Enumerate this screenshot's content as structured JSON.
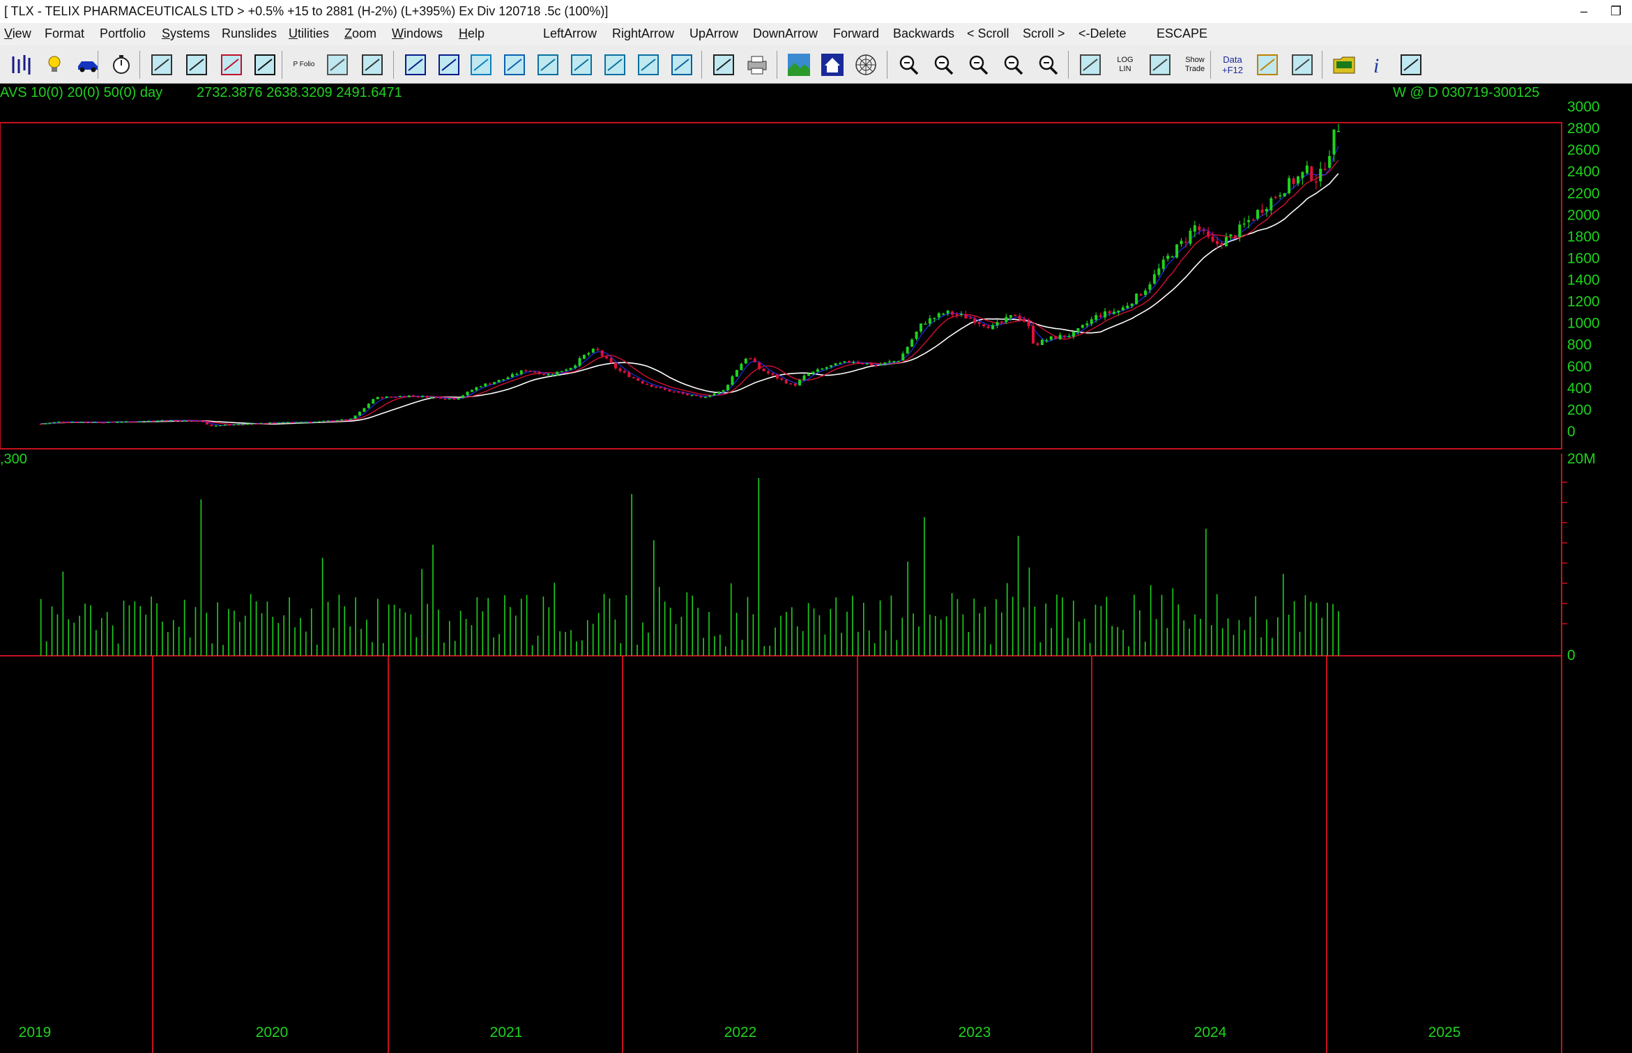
{
  "window": {
    "title": "[ TLX - TELIX PHARMACEUTICALS LTD > +0.5% +15 to 2881 (H-2%) (L+395%)    Ex Div 120718  .5c  (100%)]",
    "minimize_glyph": "–",
    "maximize_glyph": "❐"
  },
  "menu": [
    {
      "label": "View",
      "ul": "V",
      "rest": "iew"
    },
    {
      "label": "Format",
      "ul": "",
      "rest": "Format"
    },
    {
      "label": "Portfolio",
      "ul": "",
      "rest": "Portfolio"
    },
    {
      "label": "Systems",
      "ul": "S",
      "rest": "ystems"
    },
    {
      "label": "Runslides",
      "ul": "",
      "rest": "Runslides"
    },
    {
      "label": "Utilities",
      "ul": "U",
      "rest": "tilities"
    },
    {
      "label": "Zoom",
      "ul": "Z",
      "rest": "oom"
    },
    {
      "label": "Windows",
      "ul": "W",
      "rest": "indows"
    },
    {
      "label": "Help",
      "ul": "H",
      "rest": "elp"
    },
    {
      "label": "LeftArrow",
      "ul": "",
      "rest": "LeftArrow"
    },
    {
      "label": "RightArrow",
      "ul": "",
      "rest": "RightArrow"
    },
    {
      "label": "UpArrow",
      "ul": "",
      "rest": "UpArrow"
    },
    {
      "label": "DownArrow",
      "ul": "",
      "rest": "DownArrow"
    },
    {
      "label": "Forward",
      "ul": "",
      "rest": "Forward"
    },
    {
      "label": "Backwards",
      "ul": "",
      "rest": "Backwards"
    },
    {
      "label": "< Scroll",
      "ul": "",
      "rest": "< Scroll"
    },
    {
      "label": "Scroll >",
      "ul": "",
      "rest": "Scroll >"
    },
    {
      "label": "<-Delete",
      "ul": "",
      "rest": "<-Delete"
    },
    {
      "label": "ESCAPE",
      "ul": "",
      "rest": "ESCAPE"
    }
  ],
  "toolbar": {
    "icons": [
      "bars-icon",
      "lightbulb-icon",
      "car-icon",
      "stopwatch-icon",
      "indicator-1234-icon",
      "calendar-365-icon",
      "trend-tool-icon",
      "bar-type-icon",
      "portfolio-icon",
      "calculator-icon",
      "time-tool-icon",
      "window-icon",
      "overlay-icon",
      "columns-icon",
      "rows-icon",
      "chart-az-icon",
      "chart-check-icon",
      "chart-b-icon",
      "chart-link-icon",
      "grid-lines-icon",
      "export-chart-icon",
      "print-icon",
      "landscape-icon",
      "house-icon",
      "web-icon",
      "zoom-out-left-icon",
      "zoom-out-icon",
      "zoom-out-right-icon",
      "zoom-in-left-icon",
      "zoom-in-right-icon",
      "weekly-monthly-icon",
      "log-lin-icon",
      "compare-icon",
      "show-trade-icon",
      "data-f12-icon",
      "scanner-icon",
      "notes-icon",
      "folder-icon",
      "info-icon",
      "calc-grid-icon"
    ],
    "text_icons": {
      "p_folio": "P Folio",
      "log": "LOG",
      "lin": "LIN",
      "show": "Show",
      "trade": "Trade",
      "data": "Data",
      "f12": "+F12"
    }
  },
  "chart_header": {
    "moving_averages": "AVS 10(0) 20(0) 50(0)  day",
    "ma_values": "2732.3876  2638.3209  2491.6471",
    "range_info": "W @ D   030719-300125",
    "volume_label": ",300"
  },
  "colors": {
    "up": "#1fd21f",
    "down": "#e0103a",
    "axis_text": "#1fd21f",
    "panel_border": "#c8101f",
    "ma_long": "#ffffff",
    "ma_mid": "#e0103a",
    "ma_short": "#2233ff",
    "volume": "#1fd21f"
  },
  "chart_data": {
    "type": "candlestick",
    "ticker": "TLX",
    "price_axis": {
      "ticks": [
        "3000",
        "2800",
        "2600",
        "2400",
        "2200",
        "2000",
        "1800",
        "1600",
        "1400",
        "1200",
        "1000",
        "800",
        "600",
        "400",
        "200",
        "0"
      ],
      "range": [
        0,
        3000
      ]
    },
    "volume_axis": {
      "ticks": [
        "20M",
        "0"
      ]
    },
    "x_labels": [
      "2019",
      "2020",
      "2021",
      "2022",
      "2023",
      "2024",
      "2025"
    ],
    "year_boundaries": [
      2019.5,
      2020.0,
      2021.0,
      2022.0,
      2023.0,
      2024.0,
      2025.0,
      2025.1
    ],
    "anchors": [
      [
        2019.52,
        70
      ],
      [
        2019.6,
        90
      ],
      [
        2019.8,
        85
      ],
      [
        2019.95,
        95
      ],
      [
        2020.05,
        105
      ],
      [
        2020.2,
        95
      ],
      [
        2020.25,
        50
      ],
      [
        2020.3,
        60
      ],
      [
        2020.5,
        80
      ],
      [
        2020.7,
        90
      ],
      [
        2020.85,
        115
      ],
      [
        2020.9,
        200
      ],
      [
        2020.95,
        310
      ],
      [
        2021.1,
        330
      ],
      [
        2021.3,
        300
      ],
      [
        2021.4,
        420
      ],
      [
        2021.5,
        480
      ],
      [
        2021.6,
        570
      ],
      [
        2021.7,
        520
      ],
      [
        2021.8,
        600
      ],
      [
        2021.85,
        700
      ],
      [
        2021.9,
        760
      ],
      [
        2021.95,
        650
      ],
      [
        2022.0,
        560
      ],
      [
        2022.1,
        450
      ],
      [
        2022.2,
        380
      ],
      [
        2022.35,
        310
      ],
      [
        2022.45,
        380
      ],
      [
        2022.5,
        560
      ],
      [
        2022.55,
        700
      ],
      [
        2022.6,
        580
      ],
      [
        2022.7,
        470
      ],
      [
        2022.75,
        420
      ],
      [
        2022.8,
        520
      ],
      [
        2022.9,
        600
      ],
      [
        2023.0,
        650
      ],
      [
        2023.1,
        610
      ],
      [
        2023.2,
        660
      ],
      [
        2023.3,
        1000
      ],
      [
        2023.4,
        1100
      ],
      [
        2023.5,
        1050
      ],
      [
        2023.6,
        960
      ],
      [
        2023.7,
        1080
      ],
      [
        2023.75,
        1000
      ],
      [
        2023.78,
        800
      ],
      [
        2023.85,
        860
      ],
      [
        2023.95,
        900
      ],
      [
        2024.05,
        1070
      ],
      [
        2024.15,
        1120
      ],
      [
        2024.25,
        1300
      ],
      [
        2024.35,
        1600
      ],
      [
        2024.43,
        1780
      ],
      [
        2024.47,
        1900
      ],
      [
        2024.55,
        1720
      ],
      [
        2024.63,
        1800
      ],
      [
        2024.75,
        2050
      ],
      [
        2024.85,
        2250
      ],
      [
        2024.95,
        2400
      ],
      [
        2025.0,
        2320
      ],
      [
        2025.05,
        2620
      ],
      [
        2025.08,
        2820
      ]
    ],
    "volume_spikes": [
      [
        2020.21,
        17.6
      ],
      [
        2022.06,
        18.2
      ],
      [
        2022.61,
        20.0
      ],
      [
        2023.3,
        15.6
      ],
      [
        2024.52,
        14.3
      ],
      [
        2022.15,
        13.0
      ],
      [
        2021.2,
        12.5
      ],
      [
        2023.7,
        13.5
      ]
    ]
  }
}
